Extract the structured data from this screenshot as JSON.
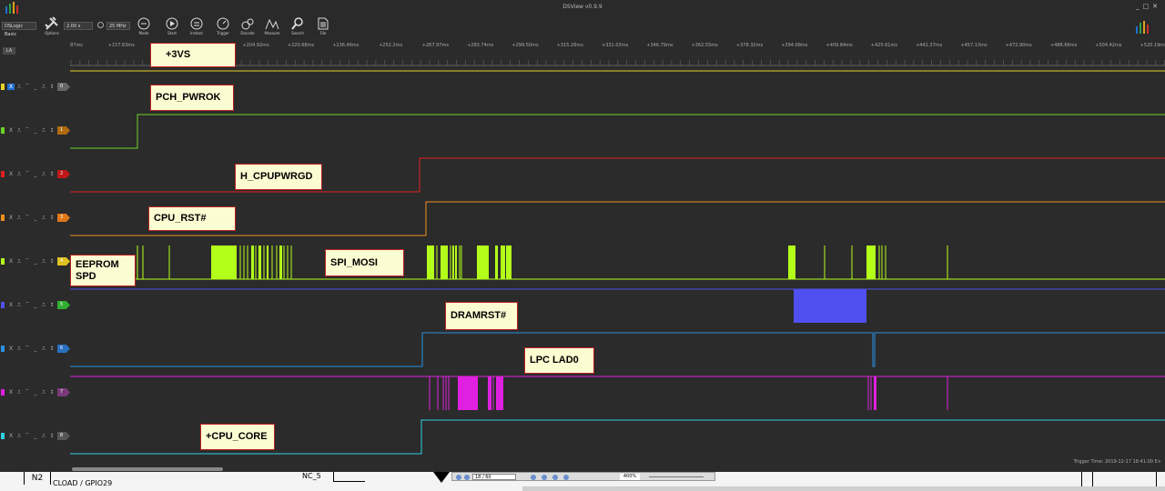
{
  "app": {
    "title": "DSView v0.9.9"
  },
  "toolbar": {
    "device": "DSLogic Basic",
    "time": "2.00 s",
    "rate": "25 MHz",
    "buttons": [
      {
        "name": "options-button",
        "icon": "wrench-screwdriver-icon",
        "label": "Options"
      },
      {
        "name": "mode-button",
        "icon": "mode-icon",
        "label": "Mode"
      },
      {
        "name": "start-button",
        "icon": "play-icon",
        "label": "Start"
      },
      {
        "name": "instant-button",
        "icon": "instant-icon",
        "label": "Instant"
      },
      {
        "name": "trigger-button",
        "icon": "trigger-icon",
        "label": "Trigger"
      },
      {
        "name": "decode-button",
        "icon": "decode-icon",
        "label": "Decode"
      },
      {
        "name": "measure-button",
        "icon": "measure-icon",
        "label": "Measure"
      },
      {
        "name": "search-button",
        "icon": "search-icon",
        "label": "Search"
      },
      {
        "name": "file-button",
        "icon": "file-icon",
        "label": "File"
      }
    ]
  },
  "ruler": {
    "badge": "LA",
    "ticks": [
      "87ms",
      "+157.63ms",
      "+173.4ms",
      "+189.16ms",
      "+204.92ms",
      "+220.68ms",
      "+236.46ms",
      "+252.2ms",
      "+267.97ms",
      "+283.74ms",
      "+299.50ms",
      "+315.26ms",
      "+331.03ms",
      "+346.79ms",
      "+362.55ms",
      "+378.32ms",
      "+394.08ms",
      "+409.84ms",
      "+425.61ms",
      "+441.37ms",
      "+457.13ms",
      "+472.90ms",
      "+488.66ms",
      "+504.42ms",
      "+520.19ms",
      "+535.9"
    ]
  },
  "channels": [
    {
      "index": "0",
      "color": "#e8d22a",
      "badge_color": "#666666"
    },
    {
      "index": "1",
      "color": "#6bd32a",
      "badge_color": "#b06a10"
    },
    {
      "index": "2",
      "color": "#e02020",
      "badge_color": "#c01818"
    },
    {
      "index": "3",
      "color": "#f09020",
      "badge_color": "#e07818"
    },
    {
      "index": "4",
      "color": "#b4ff1a",
      "badge_color": "#e0c020"
    },
    {
      "index": "5",
      "color": "#5050f0",
      "badge_color": "#30b030"
    },
    {
      "index": "6",
      "color": "#2a90e0",
      "badge_color": "#2a70c0"
    },
    {
      "index": "7",
      "color": "#e020e0",
      "badge_color": "#7a3a7a"
    },
    {
      "index": "8",
      "color": "#30d0e0",
      "badge_color": "#555555"
    }
  ],
  "labels": [
    {
      "text": "+3VS"
    },
    {
      "text": "PCH_PWROK"
    },
    {
      "text": "H_CPUPWRGD"
    },
    {
      "text": "CPU_RST#"
    },
    {
      "text": "EEPROM SPD"
    },
    {
      "text": "SPI_MOSI"
    },
    {
      "text": "DRAMRST#"
    },
    {
      "text": "LPC LAD0"
    },
    {
      "text": "+CPU_CORE"
    }
  ],
  "status": {
    "trigger_time": "Trigger Time: 2019-12-17 18:41:00 E+"
  },
  "underlay": {
    "n2": "N2",
    "cload": "CLOAD / GPIO29",
    "nc5": "NC_5",
    "pdf_page": "18 / 60",
    "pdf_zoom": "400%"
  }
}
